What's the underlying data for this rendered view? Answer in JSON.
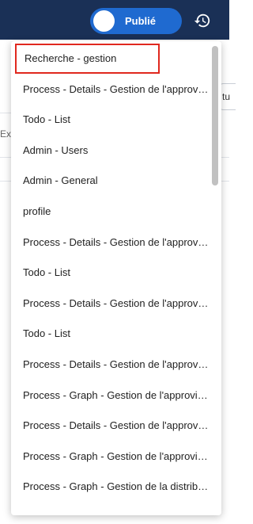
{
  "header": {
    "publish_toggle_label": "Publié",
    "history_icon": "history-icon"
  },
  "background": {
    "left_fragment": "Exte",
    "right_fragment": "tu"
  },
  "dropdown": {
    "items": [
      {
        "label": "Recherche - gestion",
        "highlighted": true
      },
      {
        "label": "Process - Details - Gestion de l'approvisionnement"
      },
      {
        "label": "Todo - List"
      },
      {
        "label": "Admin - Users"
      },
      {
        "label": "Admin - General"
      },
      {
        "label": "profile"
      },
      {
        "label": "Process - Details - Gestion de l'approvisionnement"
      },
      {
        "label": "Todo - List"
      },
      {
        "label": "Process - Details - Gestion de l'approvisionnement"
      },
      {
        "label": "Todo - List"
      },
      {
        "label": "Process - Details - Gestion de l'approvisionnement"
      },
      {
        "label": "Process - Graph - Gestion de l'approvisionnement"
      },
      {
        "label": "Process - Details - Gestion de l'approvisionnement"
      },
      {
        "label": "Process - Graph - Gestion de l'approvisionnement"
      },
      {
        "label": "Process - Graph - Gestion de la distribution"
      }
    ],
    "highlight_color": "#e0281e"
  },
  "colors": {
    "topbar": "#1a3056",
    "toggle": "#1f6ad0"
  }
}
